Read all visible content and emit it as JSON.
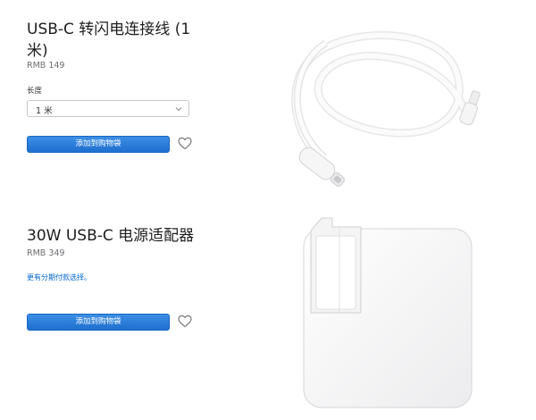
{
  "products": [
    {
      "title": "USB-C 转闪电连接线 (1 米)",
      "price": "RMB 149",
      "option_label": "长度",
      "option_value": "1 米",
      "add_button": "添加到购物袋",
      "image_icon": "usb-c-to-lightning-cable"
    },
    {
      "title": "30W USB-C 电源适配器",
      "price": "RMB 349",
      "installment_link": "更有分期付款选择。",
      "add_button": "添加到购物袋",
      "image_icon": "usb-c-power-adapter"
    }
  ],
  "colors": {
    "accent": "#0071e3",
    "button": "#2a7bd8",
    "link": "#0066cc"
  }
}
